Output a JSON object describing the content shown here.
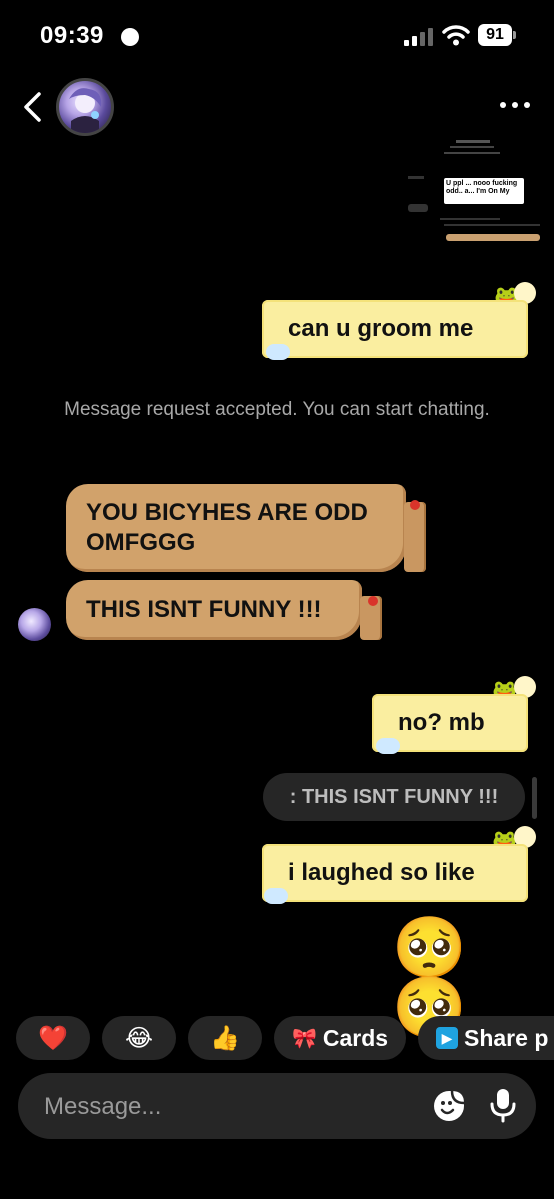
{
  "status_bar": {
    "time": "09:39",
    "battery": "91"
  },
  "header": {
    "back_icon": "chevron-left-icon",
    "avatar_icon": "profile-avatar",
    "more_icon": "more-horizontal-icon"
  },
  "shared_screenshot": {
    "caption_text": "U ppl ... nooo fucking odd.. a... I'm On My"
  },
  "messages": [
    {
      "side": "out",
      "text": "can u groom me"
    },
    {
      "side": "system",
      "text": "Message request accepted. You can start chatting."
    },
    {
      "side": "in",
      "text": "YOU BICYHES ARE ODD OMFGGG"
    },
    {
      "side": "in",
      "text": "THIS ISNT FUNNY !!!"
    },
    {
      "side": "out",
      "text": "no? mb"
    },
    {
      "side": "reply",
      "text": ": THIS ISNT FUNNY !!!"
    },
    {
      "side": "out",
      "text": "i laughed so like"
    },
    {
      "side": "out-emoji",
      "text": "🥺 🥺"
    }
  ],
  "quick_actions": [
    {
      "icon": "heart-icon",
      "glyph": "❤️"
    },
    {
      "icon": "laughing-emoji-icon",
      "glyph": "😂"
    },
    {
      "icon": "thumbs-up-icon",
      "glyph": "👍"
    },
    {
      "icon": "cards-icon",
      "glyph": "🎀",
      "label": "Cards"
    },
    {
      "icon": "share-icon",
      "glyph": "▶",
      "label": "Share p"
    }
  ],
  "composer": {
    "placeholder": "Message...",
    "sticker_icon": "sticker-icon",
    "mic_icon": "microphone-icon"
  },
  "colors": {
    "outgoing_bubble": "#faeea0",
    "incoming_bubble": "#d1a26b",
    "system_text": "#a8a8a8",
    "background": "#000000"
  }
}
